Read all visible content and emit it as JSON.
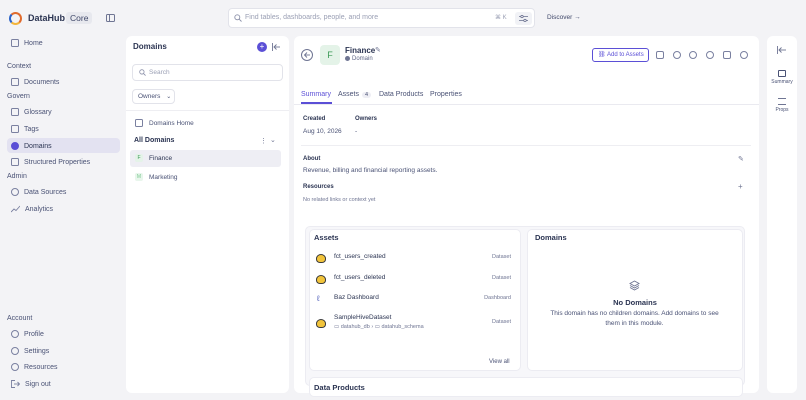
{
  "colors": {
    "accent": "#5b4fd6",
    "active_nav_bg": "#e3e2f1",
    "domain_finance": "#3a9a55",
    "domain_marketing": "#7cc88f"
  },
  "header": {
    "brand": "DataHub",
    "edition": "Core",
    "search_placeholder": "Find tables, dashboards, people, and more",
    "search_shortcut": "⌘ K",
    "discover": "Discover →"
  },
  "nav": {
    "home": "Home",
    "context_section": "Context",
    "documents": "Documents",
    "govern_section": "Govern",
    "glossary": "Glossary",
    "tags": "Tags",
    "domains": "Domains",
    "structured_properties": "Structured Properties",
    "admin_section": "Admin",
    "data_sources": "Data Sources",
    "analytics": "Analytics",
    "account_section": "Account",
    "profile": "Profile",
    "settings": "Settings",
    "resources": "Resources",
    "sign_out": "Sign out"
  },
  "domains_panel": {
    "title": "Domains",
    "search_placeholder": "Search",
    "owners_filter": "Owners",
    "domains_home": "Domains Home",
    "all_domains": "All Domains",
    "items": [
      {
        "letter": "F",
        "label": "Finance",
        "selected": true
      },
      {
        "letter": "M",
        "label": "Marketing",
        "selected": false
      }
    ]
  },
  "entity": {
    "avatar_letter": "F",
    "name": "Finance",
    "type": "Domain",
    "add_to_assets": "Add to Assets",
    "tabs": {
      "summary": "Summary",
      "assets": "Assets",
      "assets_count": "4",
      "data_products": "Data Products",
      "properties": "Properties"
    },
    "created_label": "Created",
    "created_value": "Aug 10, 2026",
    "owners_label": "Owners",
    "owners_value": "-",
    "about_label": "About",
    "about_text": "Revenue, billing and financial reporting assets.",
    "resources_label": "Resources",
    "resources_empty": "No related links or context yet"
  },
  "assets_card": {
    "title": "Assets",
    "rows": [
      {
        "name": "fct_users_created",
        "type": "Dataset",
        "icon": "hive-icon"
      },
      {
        "name": "fct_users_deleted",
        "type": "Dataset",
        "icon": "hive-icon"
      },
      {
        "name": "Baz Dashboard",
        "type": "Dashboard",
        "icon": "looker-icon"
      },
      {
        "name": "SampleHiveDataset",
        "type": "Dataset",
        "icon": "hive-icon",
        "path_db": "datahub_db",
        "path_schema": "datahub_schema"
      }
    ],
    "view_all": "View all"
  },
  "domains_card": {
    "title": "Domains",
    "empty_title": "No Domains",
    "empty_text": "This domain has no children domains. Add domains to see them in this module."
  },
  "data_products_title": "Data Products",
  "rail": {
    "summary": "Summary",
    "props": "Props"
  }
}
